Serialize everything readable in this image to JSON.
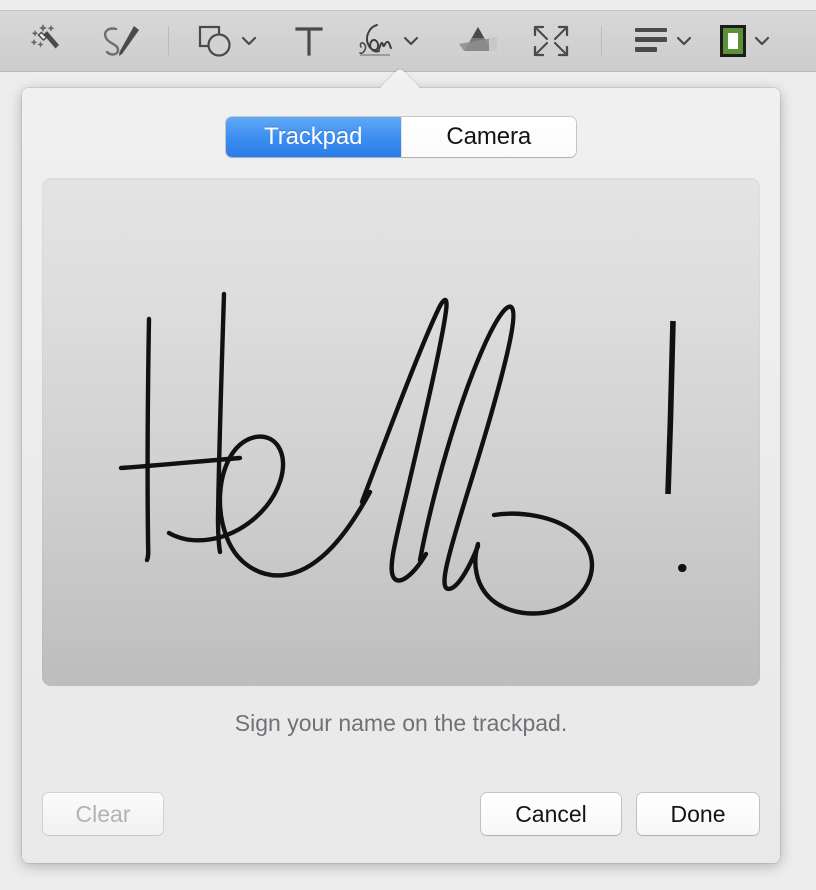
{
  "toolbar": {
    "items": [
      {
        "name": "instant-alpha-icon",
        "label": "Instant Alpha",
        "has_chevron": false
      },
      {
        "name": "sketch-icon",
        "label": "Sketch",
        "has_chevron": false
      },
      {
        "name": "shapes-icon",
        "label": "Shapes",
        "has_chevron": true
      },
      {
        "name": "text-icon",
        "label": "Text",
        "has_chevron": false
      },
      {
        "name": "signature-icon",
        "label": "Sign",
        "has_chevron": true
      },
      {
        "name": "adjust-color-icon",
        "label": "Adjust Color",
        "has_chevron": false
      },
      {
        "name": "adjust-size-icon",
        "label": "Adjust Size",
        "has_chevron": false
      },
      {
        "name": "text-style-icon",
        "label": "Text Style",
        "has_chevron": true
      },
      {
        "name": "border-color-icon",
        "label": "Border Color",
        "has_chevron": true
      }
    ],
    "border_color_swatch": "#5d9136"
  },
  "popover": {
    "tabs": [
      {
        "label": "Trackpad",
        "selected": true
      },
      {
        "label": "Camera",
        "selected": false
      }
    ],
    "caption": "Sign your name on the trackpad.",
    "signature_text": "Hello !",
    "buttons": {
      "clear": {
        "label": "Clear",
        "enabled": false
      },
      "cancel": {
        "label": "Cancel",
        "enabled": true
      },
      "done": {
        "label": "Done",
        "enabled": true
      }
    },
    "accent_color": "#3d8ef0",
    "ink_color": "#111111"
  }
}
